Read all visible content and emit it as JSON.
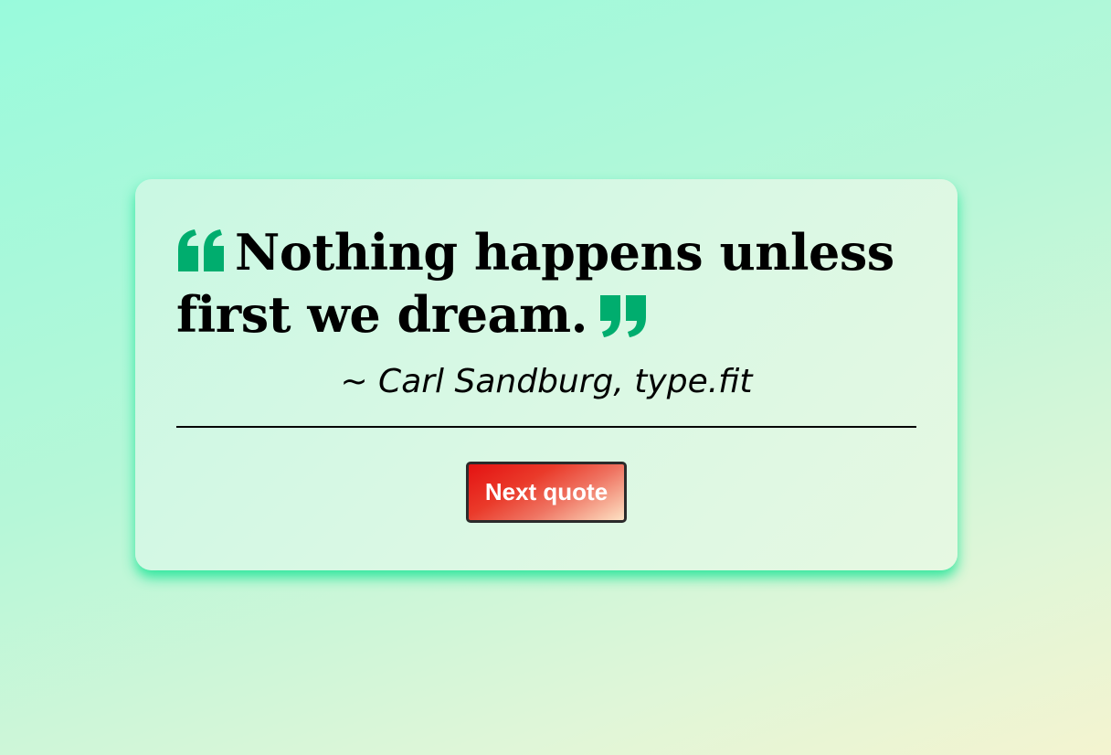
{
  "quote_card": {
    "quote_text": "Nothing happens unless first we dream.",
    "author_line": "~ Carl Sandburg, type.fit",
    "next_button_label": "Next quote"
  },
  "colors": {
    "quote_mark": "#00ad6e",
    "card_shadow": "#18e494",
    "button_start": "#e41212",
    "button_end": "#fde2c4"
  },
  "icons": {
    "open_quote": "open-quote-icon",
    "close_quote": "close-quote-icon"
  }
}
